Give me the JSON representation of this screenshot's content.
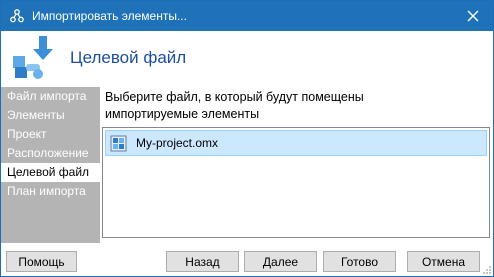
{
  "window": {
    "title": "Импортировать элементы...",
    "icons": {
      "app": "app-nodes-icon",
      "close": "close-icon"
    }
  },
  "header": {
    "title": "Целевой файл",
    "icon": "import-arrow-icon"
  },
  "steps": [
    {
      "label": "Файл импорта",
      "active": false
    },
    {
      "label": "Элементы",
      "active": false
    },
    {
      "label": "Проект",
      "active": false
    },
    {
      "label": "Расположение",
      "active": false
    },
    {
      "label": "Целевой файл",
      "active": true
    },
    {
      "label": "План импорта",
      "active": false
    }
  ],
  "content": {
    "prompt": "Выберите файл, в который будут помещены импортируемые элементы",
    "files": [
      {
        "name": "My-project.omx",
        "selected": true,
        "icon": "project-file-icon"
      }
    ]
  },
  "buttons": {
    "help": "Помощь",
    "back": "Назад",
    "next": "Далее",
    "finish": "Готово",
    "cancel": "Отмена"
  },
  "colors": {
    "titlebar": "#1f72b8",
    "step_panel": "#b4b4b4",
    "header_title": "#1f4e9e",
    "selection": "#cce8ff"
  }
}
